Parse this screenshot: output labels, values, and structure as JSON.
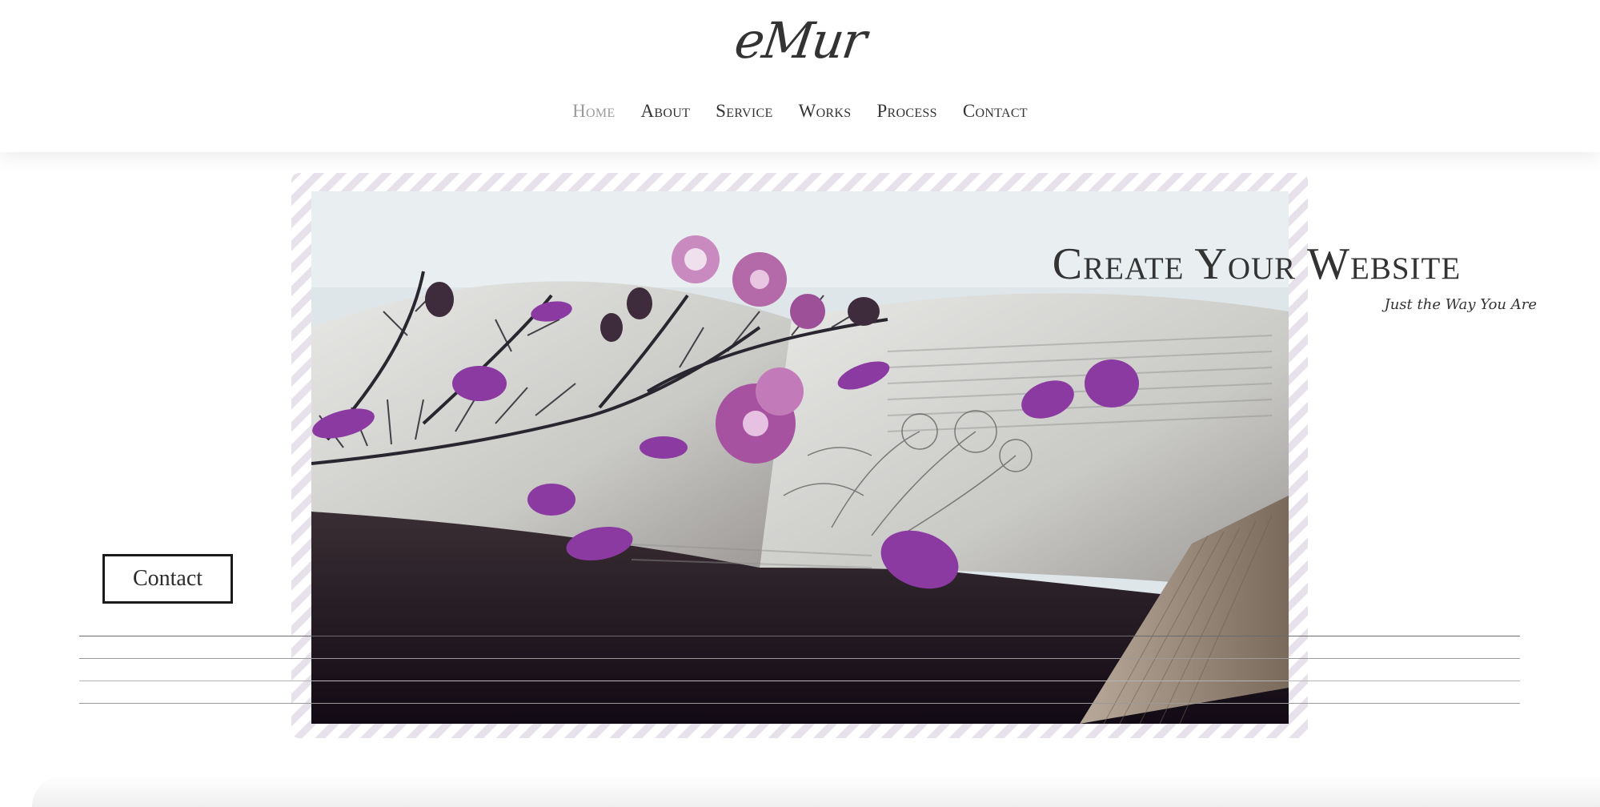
{
  "brand": {
    "logo_text": "eMur"
  },
  "nav": {
    "items": [
      {
        "label": "Home",
        "active": true
      },
      {
        "label": "About",
        "active": false
      },
      {
        "label": "Service",
        "active": false
      },
      {
        "label": "Works",
        "active": false
      },
      {
        "label": "Process",
        "active": false
      },
      {
        "label": "Contact",
        "active": false
      }
    ]
  },
  "hero": {
    "title": "Create Your Website",
    "subtitle": "Just the Way You Are",
    "contact_button_label": "Contact",
    "image_subject": "open book with purple flowers"
  },
  "colors": {
    "text": "#2b2b2b",
    "nav_active": "#9a9a9a",
    "frame_stripe": "#e6e1ea",
    "petal_purple": "#8a3aa0",
    "button_border": "#1a1a1a"
  }
}
